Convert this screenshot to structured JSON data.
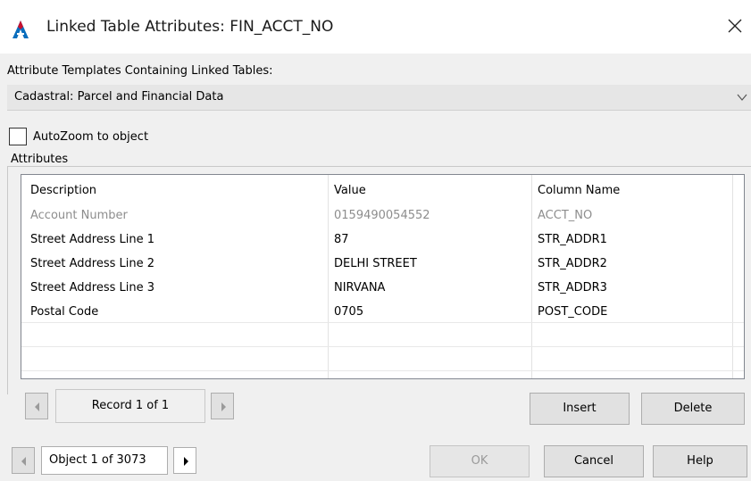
{
  "window": {
    "title": "Linked Table Attributes: FIN_ACCT_NO",
    "app_icon": "autocad-map-icon",
    "close_icon": "close-icon"
  },
  "templates": {
    "label": "Attribute Templates Containing Linked Tables:",
    "selected": "Cadastral: Parcel and Financial Data"
  },
  "autozoom": {
    "label": "AutoZoom to object",
    "checked": false
  },
  "attributes": {
    "group_label": "Attributes",
    "columns": [
      "Description",
      "Value",
      "Column Name"
    ],
    "rows": [
      {
        "description": "Account Number",
        "value": "0159490054552",
        "column": "ACCT_NO",
        "readonly": true
      },
      {
        "description": "Street Address Line 1",
        "value": "87",
        "column": "STR_ADDR1",
        "readonly": false
      },
      {
        "description": "Street Address Line 2",
        "value": "DELHI STREET",
        "column": "STR_ADDR2",
        "readonly": false
      },
      {
        "description": "Street Address Line 3",
        "value": "NIRVANA",
        "column": "STR_ADDR3",
        "readonly": false
      },
      {
        "description": "Postal Code",
        "value": "0705",
        "column": "POST_CODE",
        "readonly": false
      }
    ]
  },
  "record_nav": {
    "label": "Record 1 of 1"
  },
  "buttons": {
    "insert": "Insert",
    "delete": "Delete",
    "ok": "OK",
    "cancel": "Cancel",
    "help": "Help"
  },
  "object_nav": {
    "label": "Object 1 of 3073"
  },
  "colors": {
    "titlebar_bg": "#ffffff",
    "dialog_bg": "#f0f0f0",
    "autocad_red": "#c8102e",
    "autocad_blue": "#0a6ebd",
    "disabled_text": "#8d8d8d"
  }
}
